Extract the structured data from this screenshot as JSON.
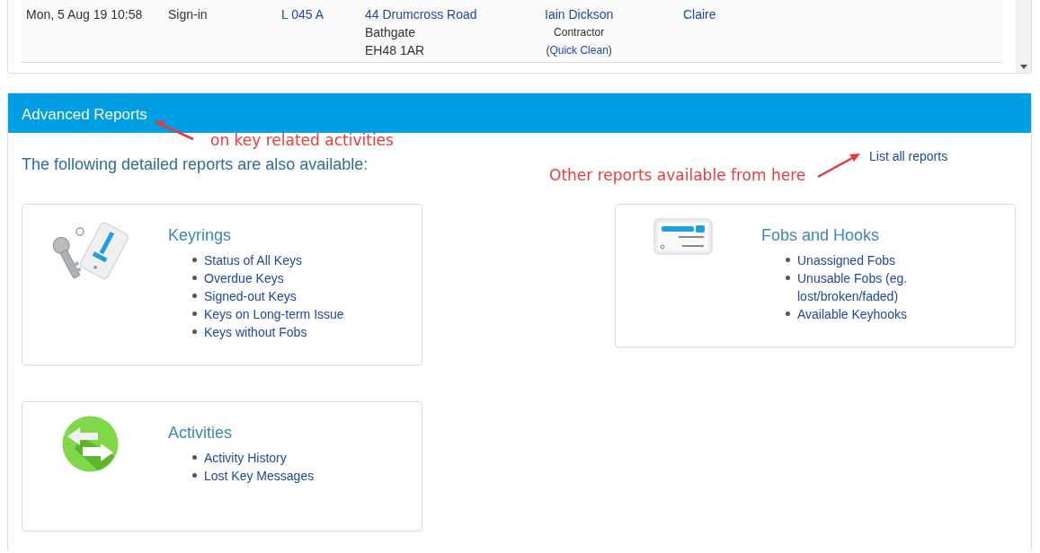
{
  "activity_table": {
    "rows": [
      {
        "date": "Mon, 5 Aug 19 10:58",
        "activity": "Sign-in",
        "key": "L 045 A",
        "address_link": "44 Drumcross Road",
        "address_lines": [
          "Bathgate",
          "EH48 1AR"
        ],
        "person": "Iain Dickson",
        "role": "Contractor",
        "company_open": "(",
        "company": "Quick Clean",
        "company_close": ")",
        "user": "Claire"
      }
    ]
  },
  "advanced_reports": {
    "title": "Advanced Reports",
    "intro": "The following detailed reports are also available:",
    "list_all_link": "List all reports",
    "cards": [
      {
        "kind": "keyring",
        "title": "Keyrings",
        "links": [
          "Status of All Keys",
          "Overdue Keys",
          "Signed-out Keys",
          "Keys on Long-term Issue",
          "Keys without Fobs"
        ]
      },
      {
        "kind": "fob",
        "title": "Fobs and Hooks",
        "links": [
          "Unassigned Fobs",
          "Unusable Fobs (eg. lost/broken/faded)",
          "Available Keyhooks"
        ]
      },
      {
        "kind": "activity",
        "title": "Activities",
        "links": [
          "Activity History",
          "Lost Key Messages"
        ]
      }
    ]
  },
  "annotations": [
    {
      "text": "on key related activities"
    },
    {
      "text": "Other reports available from here"
    }
  ]
}
